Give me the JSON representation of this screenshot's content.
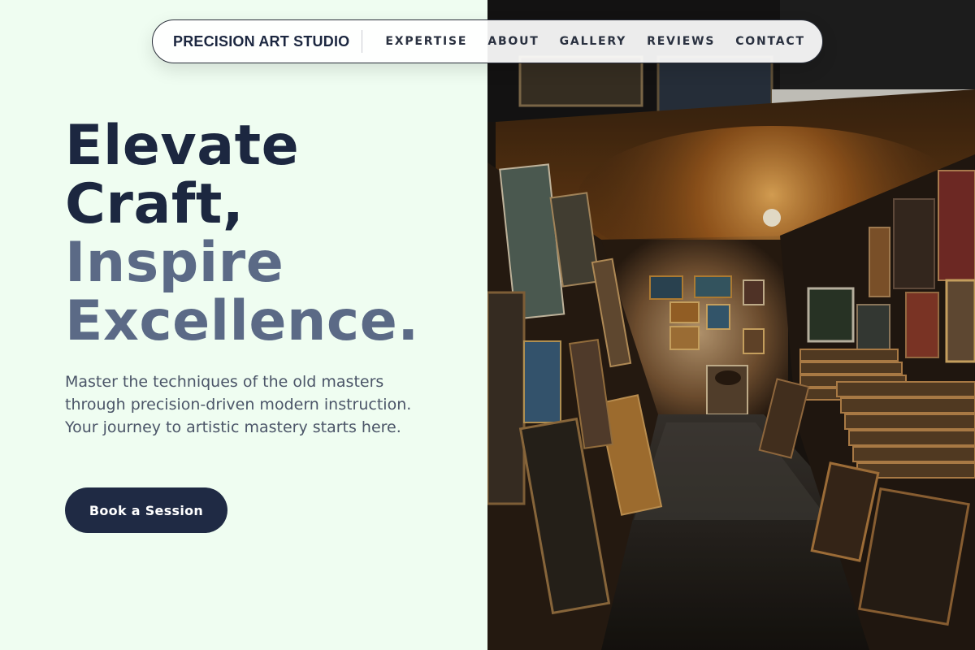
{
  "nav": {
    "brand": "PRECISION ART STUDIO",
    "links": [
      "EXPERTISE",
      "ABOUT",
      "GALLERY",
      "REVIEWS",
      "CONTACT"
    ]
  },
  "hero": {
    "headline_line1": "Elevate",
    "headline_line2": "Craft,",
    "headline_line3": "Inspire",
    "headline_line4": "Excellence.",
    "lede": "Master the techniques of the old masters through precision-driven modern instruction. Your journey to artistic mastery starts here.",
    "cta_label": "Book a Session"
  },
  "image": {
    "subject": "art-gallery-corridor-photo"
  },
  "colors": {
    "background": "#effdf1",
    "navy": "#1c2740",
    "slate": "#5b6a86",
    "cta": "#1f2a44"
  }
}
